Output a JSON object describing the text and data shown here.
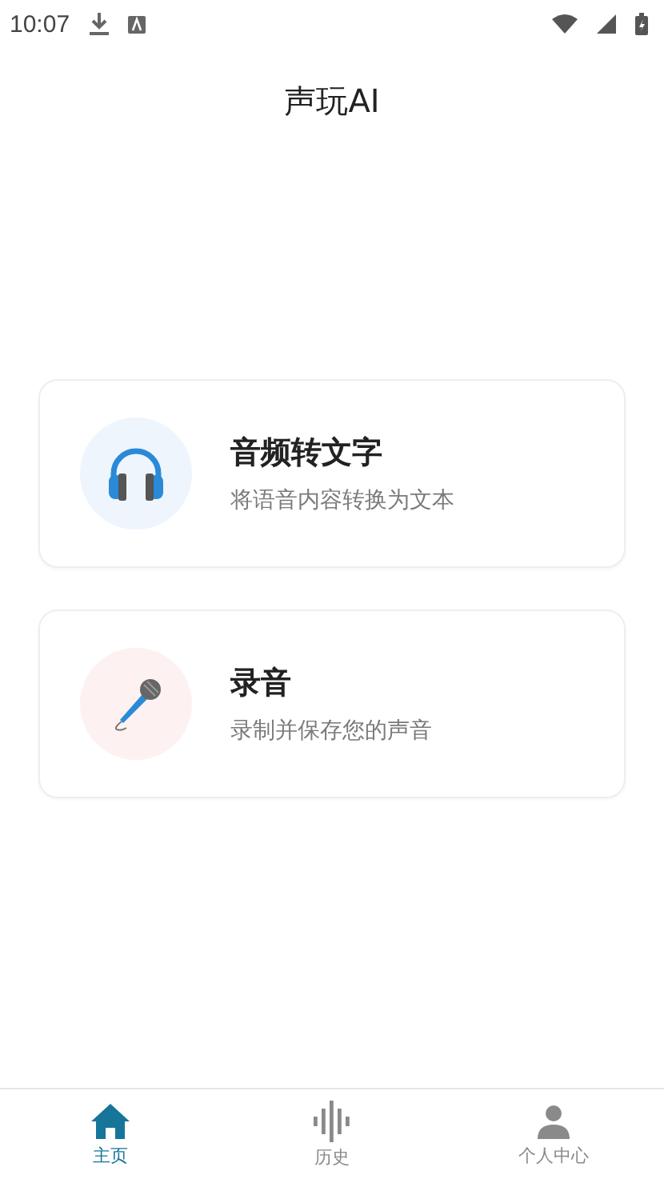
{
  "status_bar": {
    "time": "10:07"
  },
  "header": {
    "title": "声玩AI"
  },
  "features": [
    {
      "kind": "headphones",
      "color": "#eef5fd",
      "title": "音频转文字",
      "subtitle": "将语音内容转换为文本"
    },
    {
      "kind": "microphone",
      "color": "#fdf1f1",
      "title": "录音",
      "subtitle": "录制并保存您的声音"
    }
  ],
  "bottom_nav": [
    {
      "kind": "home",
      "label": "主页",
      "selected": true
    },
    {
      "kind": "history",
      "label": "历史",
      "selected": false
    },
    {
      "kind": "profile",
      "label": "个人中心",
      "selected": false
    }
  ]
}
